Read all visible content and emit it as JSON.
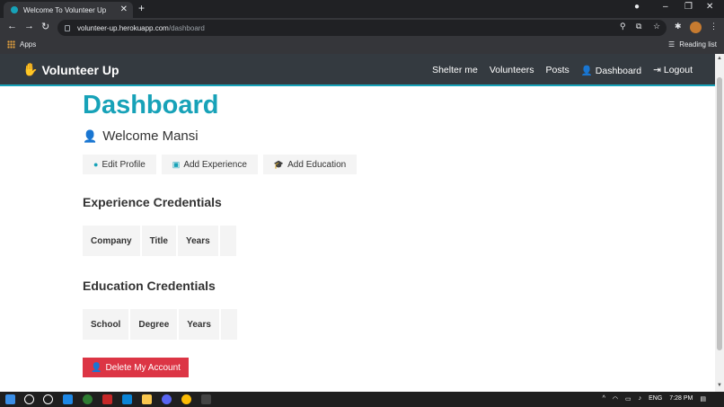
{
  "browser": {
    "tab_title": "Welcome To Volunteer Up",
    "new_tab": "+",
    "url_host": "volunteer-up.herokuapp.com",
    "url_path": "/dashboard",
    "bookmarks": {
      "apps": "Apps",
      "reading_list": "Reading list"
    }
  },
  "navbar": {
    "brand": "Volunteer Up",
    "links": [
      "Shelter me",
      "Volunteers",
      "Posts",
      "Dashboard",
      "Logout"
    ]
  },
  "dashboard": {
    "title": "Dashboard",
    "welcome": "Welcome Mansi",
    "buttons": {
      "edit_profile": "Edit Profile",
      "add_experience": "Add Experience",
      "add_education": "Add Education"
    },
    "experience": {
      "heading": "Experience Credentials",
      "columns": [
        "Company",
        "Title",
        "Years"
      ]
    },
    "education": {
      "heading": "Education Credentials",
      "columns": [
        "School",
        "Degree",
        "Years"
      ]
    },
    "delete_account": "Delete My Account"
  },
  "taskbar": {
    "lang": "ENG",
    "time": "7:28 PM"
  },
  "colors": {
    "accent": "#17a2b8",
    "navbar": "#343a40",
    "danger": "#dc3545"
  }
}
